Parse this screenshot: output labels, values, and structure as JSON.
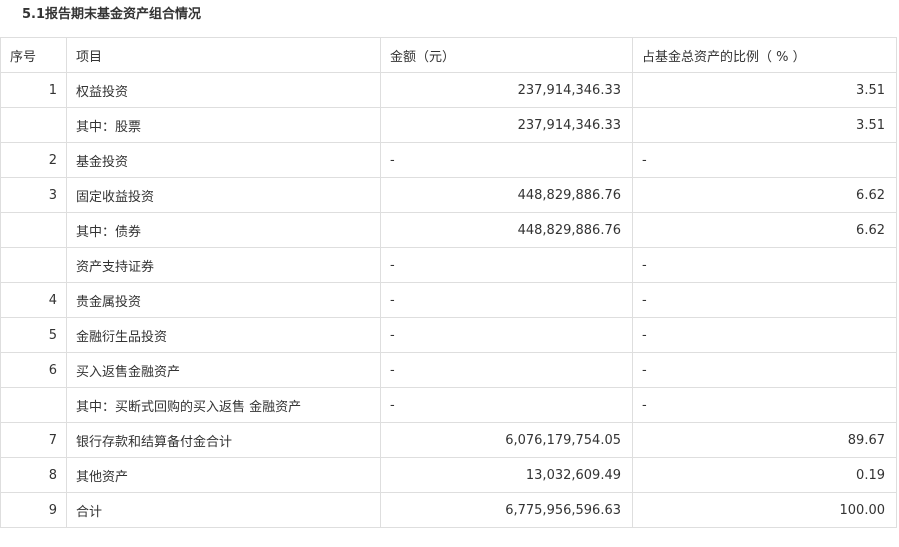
{
  "section": {
    "title": "5.1报告期末基金资产组合情况"
  },
  "table": {
    "headers": [
      "序号",
      "项目",
      "金额（元）",
      "占基金总资产的比例（ % ）"
    ],
    "rows": [
      {
        "seq": "1",
        "item": "权益投资",
        "amount": "237,914,346.33",
        "ratio": "3.51"
      },
      {
        "seq": "",
        "item": "其中：股票",
        "amount": "237,914,346.33",
        "ratio": "3.51"
      },
      {
        "seq": "2",
        "item": "基金投资",
        "amount": "-",
        "ratio": "-"
      },
      {
        "seq": "3",
        "item": "固定收益投资",
        "amount": "448,829,886.76",
        "ratio": "6.62"
      },
      {
        "seq": "",
        "item": "其中：债券",
        "amount": "448,829,886.76",
        "ratio": "6.62"
      },
      {
        "seq": "",
        "item": "资产支持证券",
        "amount": "-",
        "ratio": "-"
      },
      {
        "seq": "4",
        "item": "贵金属投资",
        "amount": "-",
        "ratio": "-"
      },
      {
        "seq": "5",
        "item": "金融衍生品投资",
        "amount": "-",
        "ratio": "-"
      },
      {
        "seq": "6",
        "item": "买入返售金融资产",
        "amount": "-",
        "ratio": "-"
      },
      {
        "seq": "",
        "item": "其中：买断式回购的买入返售 金融资产",
        "amount": "-",
        "ratio": "-"
      },
      {
        "seq": "7",
        "item": "银行存款和结算备付金合计",
        "amount": "6,076,179,754.05",
        "ratio": "89.67"
      },
      {
        "seq": "8",
        "item": "其他资产",
        "amount": "13,032,609.49",
        "ratio": "0.19"
      },
      {
        "seq": "9",
        "item": "合计",
        "amount": "6,775,956,596.63",
        "ratio": "100.00"
      }
    ]
  }
}
